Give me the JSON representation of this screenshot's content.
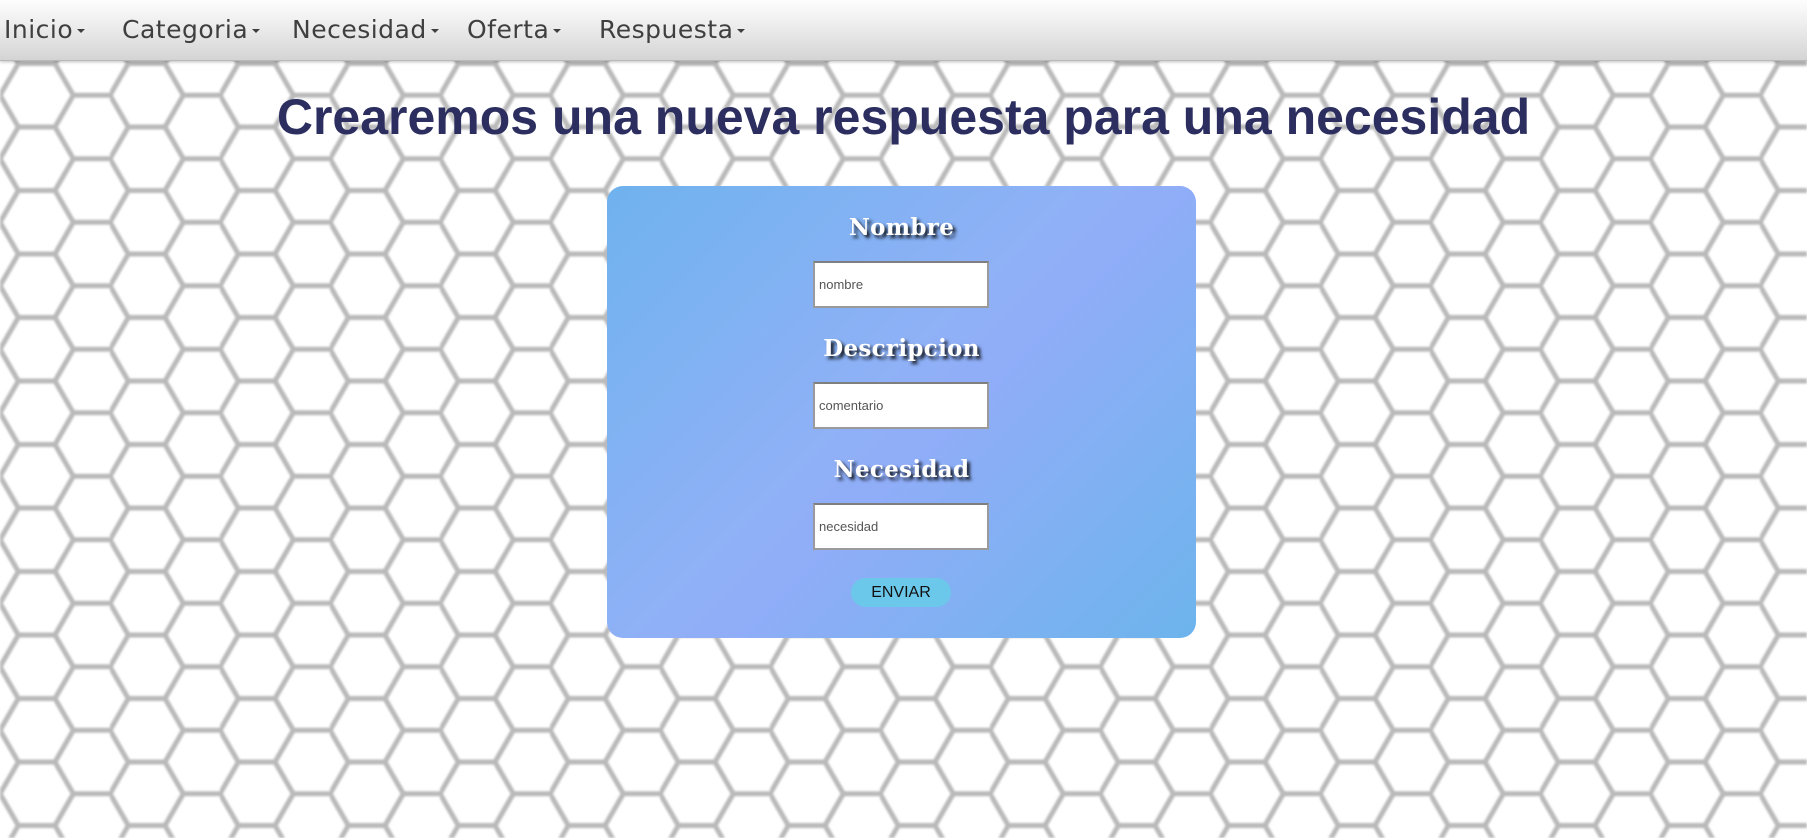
{
  "nav": {
    "items": [
      {
        "label": "Inicio"
      },
      {
        "label": "Categoria"
      },
      {
        "label": "Necesidad"
      },
      {
        "label": "Oferta"
      },
      {
        "label": "Respuesta"
      }
    ]
  },
  "page": {
    "title": "Crearemos una nueva respuesta para una necesidad"
  },
  "form": {
    "fields": [
      {
        "label": "Nombre",
        "placeholder": "nombre",
        "value": ""
      },
      {
        "label": "Descripcion",
        "placeholder": "comentario",
        "value": ""
      },
      {
        "label": "Necesidad",
        "placeholder": "necesidad",
        "value": ""
      }
    ],
    "submit_label": "ENVIAR"
  },
  "colors": {
    "title": "#2b2e5f",
    "card_gradient_start": "#6fb2ee",
    "card_gradient_mid": "#90adf8",
    "button": "#6cc8ea"
  }
}
